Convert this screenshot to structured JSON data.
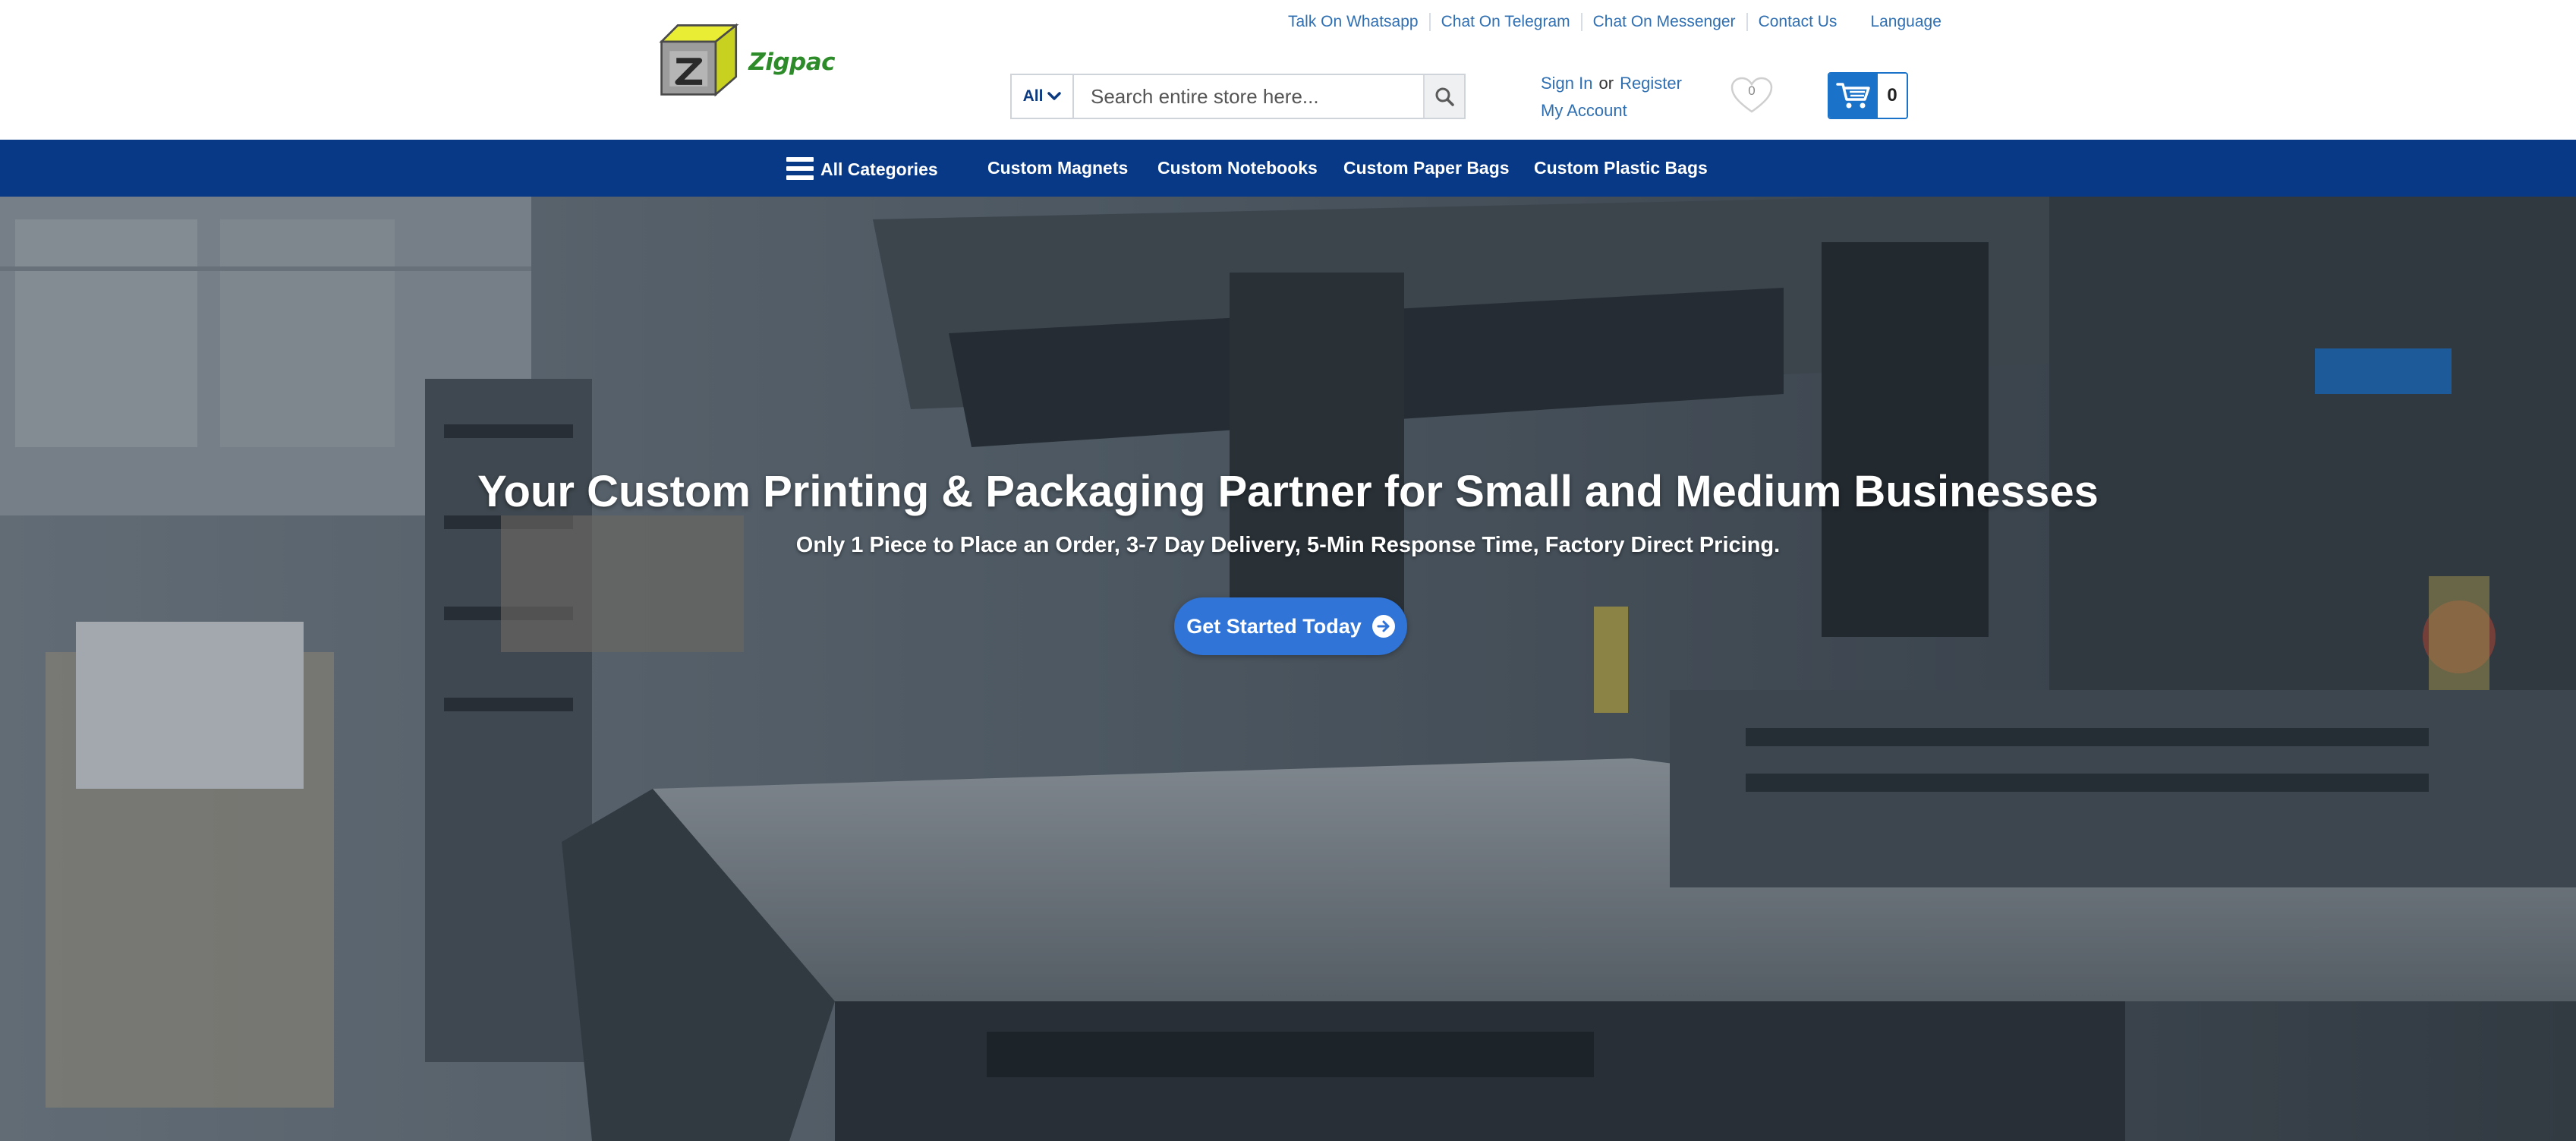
{
  "top_links": {
    "whatsapp": "Talk On Whatsapp",
    "telegram": "Chat On Telegram",
    "messenger": "Chat On Messenger",
    "contact": "Contact Us",
    "language": "Language"
  },
  "logo": {
    "brand": "Zigpac"
  },
  "search": {
    "category": "All",
    "placeholder": "Search entire store here...",
    "value": ""
  },
  "account": {
    "sign_in": "Sign In",
    "or": "or",
    "register": "Register",
    "my_account": "My Account"
  },
  "wishlist": {
    "count": "0"
  },
  "cart": {
    "count": "0"
  },
  "nav": {
    "all_categories": "All Categories",
    "items": [
      "Custom Magnets",
      "Custom Notebooks",
      "Custom Paper Bags",
      "Custom Plastic Bags"
    ]
  },
  "hero": {
    "title": "Your Custom Printing & Packaging Partner for Small and Medium Businesses",
    "subtitle": "Only 1 Piece to Place an Order, 3-7 Day Delivery, 5-Min Response Time, Factory Direct Pricing.",
    "cta": "Get Started Today"
  },
  "colors": {
    "nav_bg": "#073987",
    "link": "#2f6fb2",
    "cta": "#2f74d6",
    "cart": "#1a73c9",
    "brand_green": "#2d8c29"
  },
  "icons": [
    "logo-cube-icon",
    "chevron-down-icon",
    "search-icon",
    "heart-icon",
    "cart-icon",
    "hamburger-icon",
    "arrow-right-circle-icon"
  ]
}
